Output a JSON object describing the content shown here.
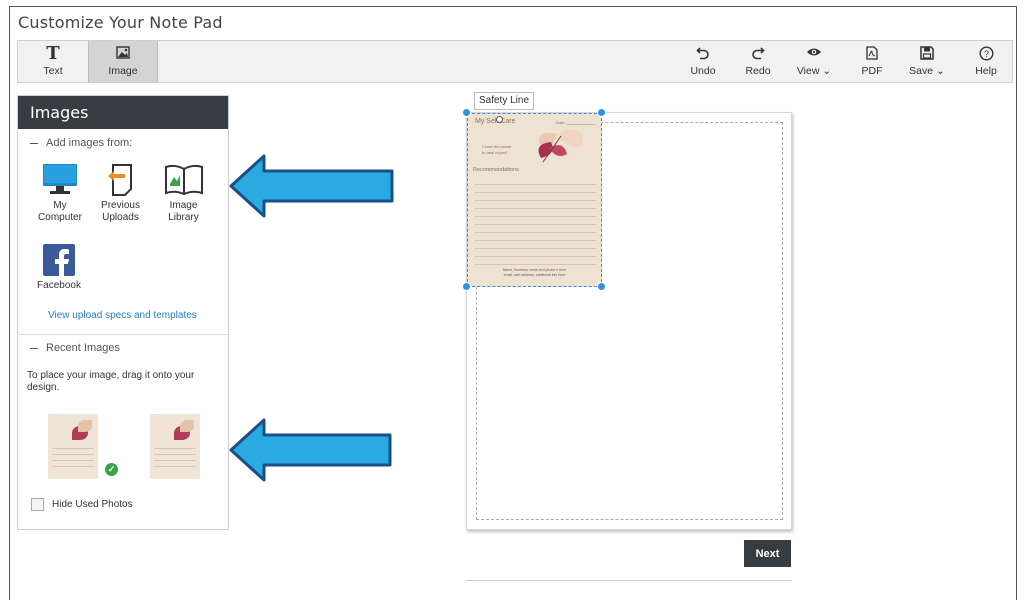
{
  "app": {
    "title": "Customize Your Note Pad"
  },
  "toolbar": {
    "left": [
      {
        "label": "Text",
        "icon": "text-icon",
        "active": false
      },
      {
        "label": "Image",
        "icon": "image-icon",
        "active": true
      }
    ],
    "right": [
      {
        "label": "Undo",
        "icon": "undo-icon"
      },
      {
        "label": "Redo",
        "icon": "redo-icon"
      },
      {
        "label": "View ⌄",
        "icon": "eye-icon"
      },
      {
        "label": "PDF",
        "icon": "pdf-icon"
      },
      {
        "label": "Save ⌄",
        "icon": "save-icon"
      },
      {
        "label": "Help",
        "icon": "help-icon"
      }
    ]
  },
  "images_panel": {
    "title": "Images",
    "add_from_label": "Add images from:",
    "sources": [
      {
        "label_line1": "My",
        "label_line2": "Computer",
        "icon": "computer-icon"
      },
      {
        "label_line1": "Previous",
        "label_line2": "Uploads",
        "icon": "previous-uploads-icon"
      },
      {
        "label_line1": "Image",
        "label_line2": "Library",
        "icon": "book-icon"
      },
      {
        "label_line1": "Facebook",
        "label_line2": "",
        "icon": "facebook-icon"
      }
    ],
    "specs_link": "View upload specs and templates",
    "recent_label": "Recent Images",
    "recent_hint_line1": "To place your image, drag it onto your",
    "recent_hint_line2": "design.",
    "hide_used_label": "Hide Used Photos"
  },
  "canvas": {
    "safety_line_label": "Safety Line",
    "placed_image": {
      "title": "My Self Care",
      "date_label": "Date:",
      "quote_line1": "I have the power",
      "quote_line2": "to heal myself",
      "section": "Recommendations",
      "footer_line1": "Name, business name and phone # here",
      "footer_line2": "email, web address, additional info here"
    }
  },
  "actions": {
    "next_label": "Next"
  },
  "colors": {
    "panel_header": "#353d40",
    "link": "#2a7bbd",
    "arrow": "#29abe2",
    "handle": "#2b93e0",
    "check": "#3aa34a"
  }
}
